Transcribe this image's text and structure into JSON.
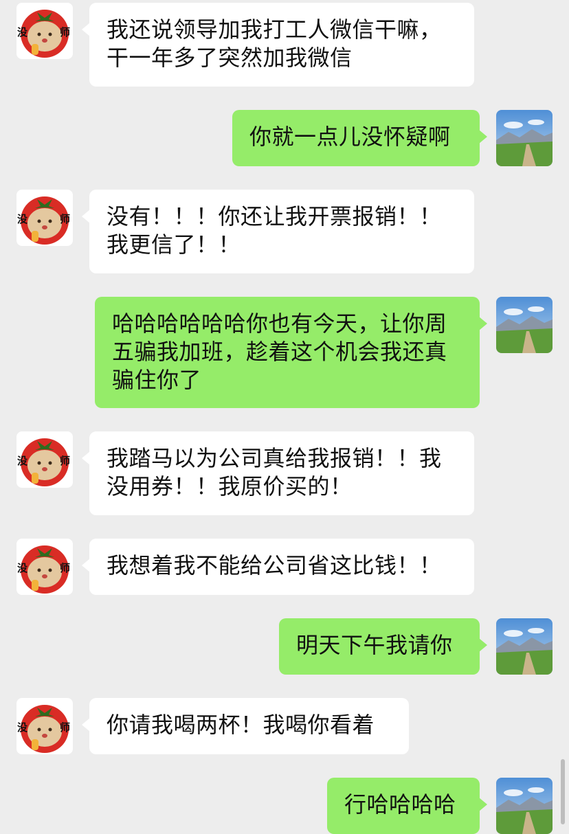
{
  "avatars": {
    "friend": {
      "icon": "tomato-avatar-icon",
      "left_char": "没",
      "right_char": "师"
    },
    "self": {
      "icon": "mountain-road-landscape-icon"
    }
  },
  "colors": {
    "background": "#ededed",
    "friend_bubble": "#ffffff",
    "self_bubble": "#95ec69"
  },
  "messages": [
    {
      "from": "friend",
      "text": "我还说领导加我打工人微信干嘛，\n干一年多了突然加我微信"
    },
    {
      "from": "self",
      "text": "你就一点儿没怀疑啊"
    },
    {
      "from": "friend",
      "text": "没有！！！你还让我开票报销！！\n我更信了！！"
    },
    {
      "from": "self",
      "text": "哈哈哈哈哈哈你也有今天，让你周\n五骗我加班，趁着这个机会我还真\n骗住你了"
    },
    {
      "from": "friend",
      "text": "我踏马以为公司真给我报销！！我\n没用券！！我原价买的！"
    },
    {
      "from": "friend",
      "text": "我想着我不能给公司省这比钱！！"
    },
    {
      "from": "self",
      "text": "明天下午我请你"
    },
    {
      "from": "friend",
      "text": "你请我喝两杯！我喝你看着"
    },
    {
      "from": "self",
      "text": "行哈哈哈哈"
    }
  ]
}
